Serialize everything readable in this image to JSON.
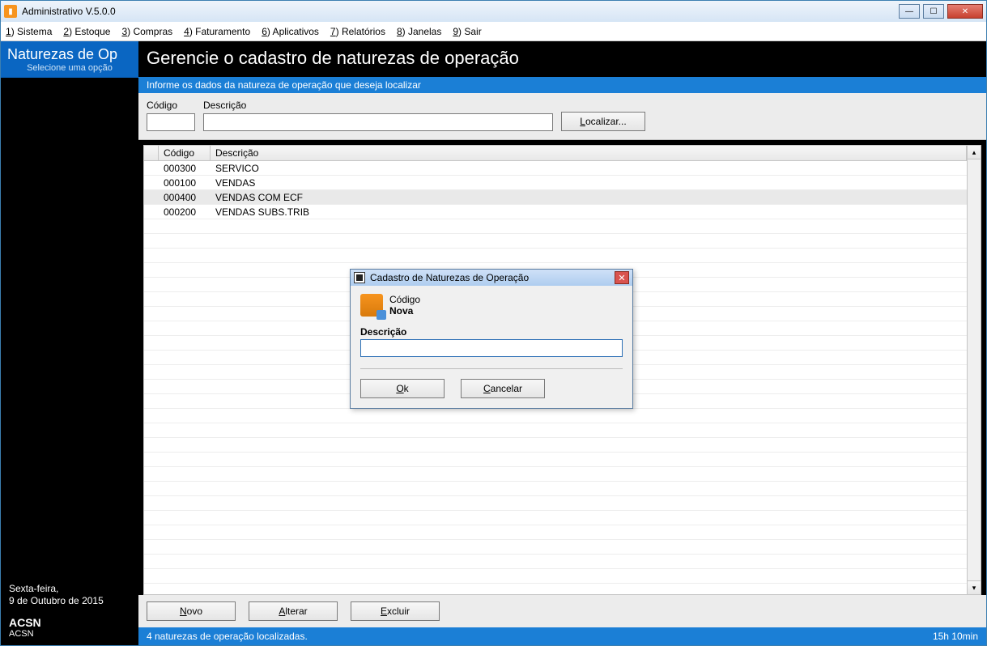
{
  "window": {
    "title": "Administrativo V.5.0.0"
  },
  "menu": {
    "items": [
      {
        "hot": "1",
        "label": ") Sistema"
      },
      {
        "hot": "2",
        "label": ") Estoque"
      },
      {
        "hot": "3",
        "label": ") Compras"
      },
      {
        "hot": "4",
        "label": ") Faturamento"
      },
      {
        "hot": "6",
        "label": ") Aplicativos"
      },
      {
        "hot": "7",
        "label": ") Relatórios"
      },
      {
        "hot": "8",
        "label": ") Janelas"
      },
      {
        "hot": "9",
        "label": ") Sair"
      }
    ]
  },
  "sidebar": {
    "title": "Naturezas de Op",
    "subtitle": "Selecione uma opção",
    "date_line1": "Sexta-feira,",
    "date_line2": "9 de Outubro de 2015",
    "company1": "ACSN",
    "company2": "ACSN"
  },
  "page": {
    "title": "Gerencie o cadastro de naturezas de operação",
    "hintbar": "Informe os dados da natureza de operação que deseja localizar"
  },
  "search": {
    "codigo_label": "Código",
    "descricao_label": "Descrição",
    "codigo_value": "",
    "descricao_value": "",
    "localizar_hot": "L",
    "localizar_rest": "ocalizar..."
  },
  "grid": {
    "headers": {
      "codigo": "Código",
      "descricao": "Descrição"
    },
    "rows": [
      {
        "codigo": "000300",
        "descricao": "SERVICO",
        "selected": false
      },
      {
        "codigo": "000100",
        "descricao": "VENDAS",
        "selected": false
      },
      {
        "codigo": "000400",
        "descricao": "VENDAS COM ECF",
        "selected": true
      },
      {
        "codigo": "000200",
        "descricao": "VENDAS SUBS.TRIB",
        "selected": false
      }
    ]
  },
  "actions": {
    "novo_hot": "N",
    "novo_rest": "ovo",
    "alterar_hot": "A",
    "alterar_rest": "lterar",
    "excluir_hot": "E",
    "excluir_rest": "xcluir"
  },
  "status": {
    "message": "4 naturezas de operação localizadas.",
    "time": "15h 10min"
  },
  "dialog": {
    "title": "Cadastro de Naturezas de Operação",
    "codigo_label": "Código",
    "codigo_value": "Nova",
    "descricao_label": "Descrição",
    "descricao_value": "",
    "ok_hot": "O",
    "ok_rest": "k",
    "cancel_hot": "C",
    "cancel_rest": "ancelar"
  }
}
